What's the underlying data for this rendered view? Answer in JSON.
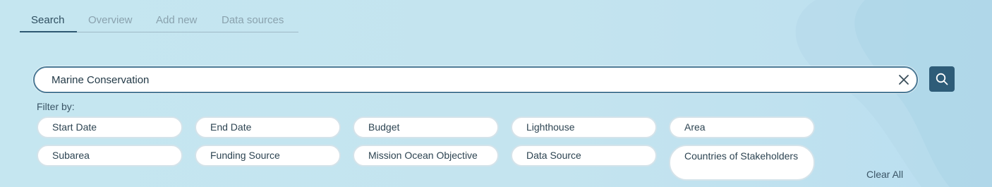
{
  "tabs": [
    {
      "label": "Search",
      "active": true
    },
    {
      "label": "Overview",
      "active": false
    },
    {
      "label": "Add new",
      "active": false
    },
    {
      "label": "Data sources",
      "active": false
    }
  ],
  "search": {
    "value": "Marine Conservation",
    "placeholder": "",
    "clear_icon": "close-icon",
    "button_icon": "search-icon"
  },
  "filters": {
    "label": "Filter by:",
    "chips": [
      "Start Date",
      "End Date",
      "Budget",
      "Lighthouse",
      "Area",
      "Subarea",
      "Funding Source",
      "Mission Ocean Objective",
      "Data Source",
      "Countries of Stakeholders"
    ],
    "clear_all": "Clear All"
  },
  "colors": {
    "background": "#c5e6f0",
    "accent": "#2e5c78",
    "tab_active": "#2e4e60",
    "tab_inactive": "#8aa2ae"
  }
}
